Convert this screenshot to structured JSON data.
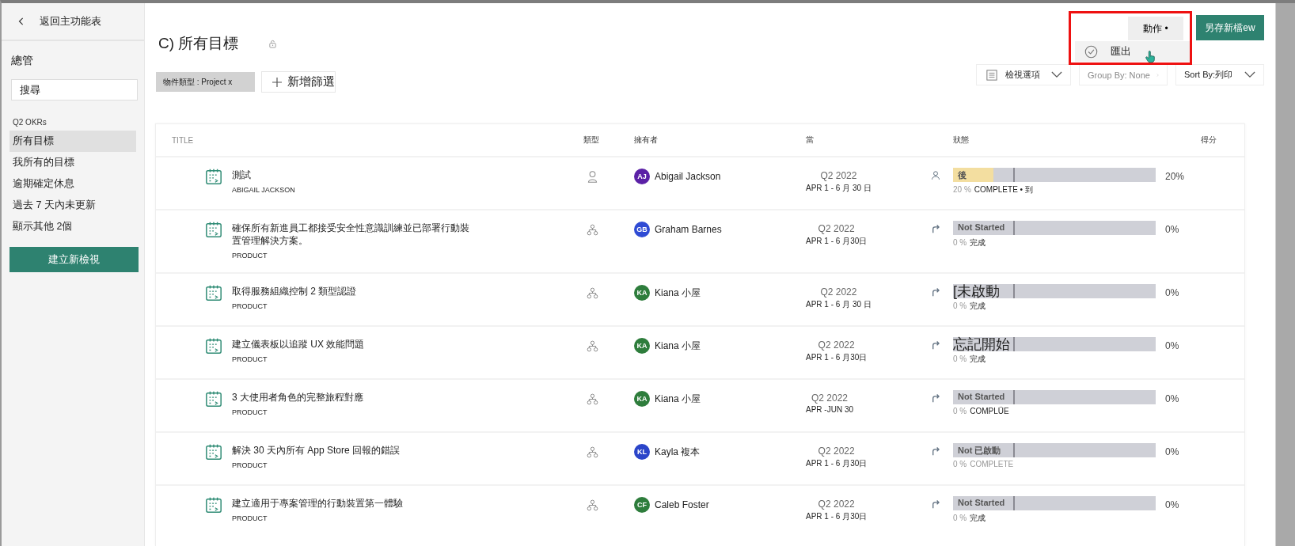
{
  "sidebar": {
    "back_label": "返回主功能表",
    "section_title": "總管",
    "search": {
      "placeholder": "搜尋"
    },
    "group_label": "Q2 OKRs",
    "items": [
      {
        "label": "所有目標",
        "selected": true
      },
      {
        "label": "我所有的目標",
        "selected": false
      },
      {
        "label": "逾期確定休息",
        "selected": false
      },
      {
        "label": "過去 7 天內未更新",
        "selected": false
      },
      {
        "label": "顯示其他 2個",
        "selected": false
      }
    ],
    "create_button": "建立新檢視"
  },
  "header": {
    "title": "C) 所有目標",
    "filter_chip": "物件類型 : Project x",
    "add_filter": "新增篩選",
    "actions_button": "動作 •",
    "save_button": "另存新檔ew",
    "actions_menu": {
      "open": true,
      "items": [
        {
          "label": "匯出"
        }
      ]
    },
    "view_options": "檢視選項",
    "group_by": "Group By: None",
    "sort_by": "Sort By:列印"
  },
  "table": {
    "columns": [
      "TITLE",
      "類型",
      "擁有者",
      "當",
      "狀態",
      "得分"
    ],
    "rows": [
      {
        "title": "測試",
        "subtitle": "ABIGAIL JACKSON",
        "type": {
          "kind": "person"
        },
        "owner": {
          "initials": "AJ",
          "name": "Abigail Jackson",
          "color": "#5b21a6"
        },
        "period": "Q2 2022",
        "dates": "APR 1 - 6 月 30 日",
        "status_icon": {
          "kind": "person"
        },
        "status": {
          "label": "後",
          "kind": "small",
          "level": 0.2
        },
        "pct": "20 %",
        "note": "COMPLETE • 到",
        "note_muted": false,
        "percent": "20%"
      },
      {
        "title": "確保所有新進員工都接受安全性意識訓練並已部署行動裝置管理解決方案。",
        "subtitle": "PRODUCT",
        "type": {
          "kind": "org"
        },
        "owner": {
          "initials": "GB",
          "name": "Graham Barnes",
          "color": "#2f4bd4"
        },
        "period": "Q2 2022",
        "dates": "APR 1 - 6 月30日",
        "status_icon": {
          "kind": "arrow"
        },
        "status": {
          "label": "Not Started",
          "kind": "small",
          "level": 0
        },
        "pct": "0 %",
        "note": "完成",
        "note_muted": false,
        "percent": "0%"
      },
      {
        "title": "取得服務組織控制 2 類型認證",
        "subtitle": "PRODUCT",
        "type": {
          "kind": "org"
        },
        "owner": {
          "initials": "KA",
          "name": "Kiana 小屋",
          "color": "#2e7d3c"
        },
        "period": "Q2 2022",
        "dates": "APR 1 - 6 月 30 日",
        "status_icon": {
          "kind": "arrow"
        },
        "status": {
          "label": "[未啟動",
          "kind": "large",
          "level": 0
        },
        "pct": "0 %",
        "note": "完成",
        "note_muted": false,
        "percent": "0%"
      },
      {
        "title": "建立儀表板以追蹤 UX 效能問題",
        "subtitle": "PRODUCT",
        "type": {
          "kind": "org"
        },
        "owner": {
          "initials": "KA",
          "name": "Kiana 小屋",
          "color": "#2e7d3c"
        },
        "period": "Q2 2022",
        "dates": "APR 1 - 6 月30日",
        "status_icon": {
          "kind": "arrow"
        },
        "status": {
          "label": "忘記開始",
          "kind": "large",
          "level": 0
        },
        "pct": "0 %",
        "note": "完成",
        "note_muted": false,
        "percent": "0%"
      },
      {
        "title": "3 大使用者角色的完整旅程對應",
        "subtitle": "PRODUCT",
        "type": {
          "kind": "org"
        },
        "owner": {
          "initials": "KA",
          "name": "Kiana 小屋",
          "color": "#2e7d3c"
        },
        "period": "Q2 2022",
        "dates": "APR -JUN 30",
        "status_icon": {
          "kind": "arrow"
        },
        "status": {
          "label": "Not Started",
          "kind": "small",
          "level": 0
        },
        "pct": "0 %",
        "note": "COMPLÜE",
        "note_muted": false,
        "percent": "0%"
      },
      {
        "title": "解決 30 天內所有 App Store 回報的錯誤",
        "subtitle": "PRODUCT",
        "type": {
          "kind": "org"
        },
        "owner": {
          "initials": "KL",
          "name": "Kayla 複本",
          "color": "#2b45c9"
        },
        "period": "Q2 2022",
        "dates": "APR 1 - 6 月30日",
        "status_icon": {
          "kind": "arrow"
        },
        "status": {
          "label": "Not 已啟動",
          "kind": "small",
          "level": 0
        },
        "pct": "0 %",
        "note": "COMPLETE",
        "note_muted": true,
        "percent": "0%"
      },
      {
        "title": "建立適用于專案管理的行動裝置第一體驗",
        "subtitle": "PRODUCT",
        "type": {
          "kind": "org"
        },
        "owner": {
          "initials": "CF",
          "name": "Caleb Foster",
          "color": "#2e7d3c"
        },
        "period": "Q2 2022",
        "dates": "APR 1 - 6 月30日",
        "status_icon": {
          "kind": "arrow"
        },
        "status": {
          "label": "Not Started",
          "kind": "small",
          "level": 0
        },
        "pct": "0 %",
        "note": "完成",
        "note_muted": false,
        "percent": "0%"
      }
    ]
  }
}
